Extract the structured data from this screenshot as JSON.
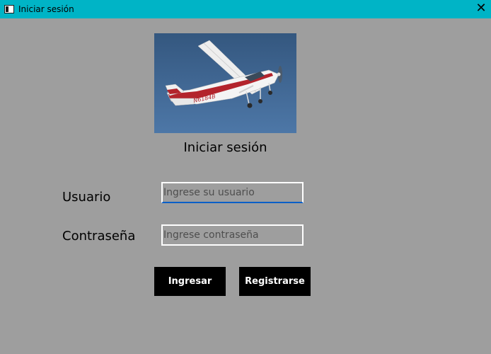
{
  "window": {
    "title": "Iniciar sesión",
    "icon": "window-app-icon",
    "close_glyph": "✕",
    "titlebar_color": "#00b4c6",
    "background_color": "#9e9e9e"
  },
  "image": {
    "subject": "airplane-photo",
    "tail_number": "N6184B"
  },
  "form": {
    "heading": "Iniciar sesión",
    "username_label": "Usuario",
    "username_placeholder": "Ingrese su usuario",
    "username_value": "",
    "password_label": "Contraseña",
    "password_placeholder": "Ingrese contraseña",
    "password_value": "",
    "login_button": "Ingresar",
    "register_button": "Registrarse"
  }
}
